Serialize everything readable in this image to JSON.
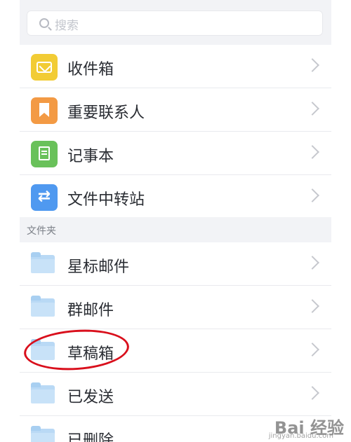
{
  "search": {
    "placeholder": "搜索"
  },
  "top_items": [
    {
      "label": "收件箱",
      "icon": "inbox-icon",
      "color": "#f2cc35"
    },
    {
      "label": "重要联系人",
      "icon": "bookmark-icon",
      "color": "#f39a44"
    },
    {
      "label": "记事本",
      "icon": "notepad-icon",
      "color": "#69c15a"
    },
    {
      "label": "文件中转站",
      "icon": "transfer-station-icon",
      "color": "#4f99f0"
    }
  ],
  "folders_header": "文件夹",
  "folders": [
    {
      "label": "星标邮件",
      "icon": "folder-icon"
    },
    {
      "label": "群邮件",
      "icon": "folder-icon"
    },
    {
      "label": "草稿箱",
      "icon": "folder-icon"
    },
    {
      "label": "已发送",
      "icon": "folder-icon"
    },
    {
      "label": "已删除",
      "icon": "folder-icon"
    }
  ],
  "annotation": {
    "highlighted_item": "草稿箱",
    "color": "#d90f1c"
  },
  "watermark": {
    "brand": "Bai 经验",
    "url": "jingyan.baidu.com"
  }
}
